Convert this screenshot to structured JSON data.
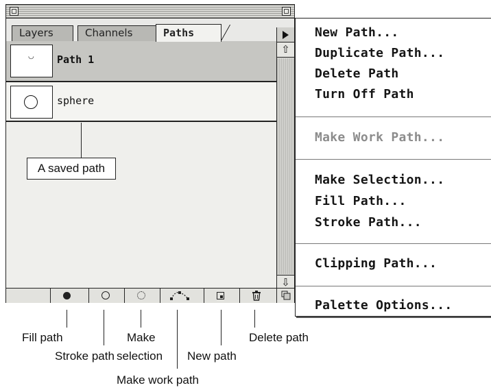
{
  "tabs": [
    "Layers",
    "Channels",
    "Paths"
  ],
  "paths": [
    {
      "name": "Path 1",
      "selected": true
    },
    {
      "name": "sphere",
      "selected": false
    }
  ],
  "callout": "A saved path",
  "toolbar_icons": [
    "fill-path-icon",
    "stroke-path-icon",
    "make-selection-icon",
    "make-work-path-icon",
    "new-path-icon",
    "trash-icon",
    "resize-icon"
  ],
  "menu": {
    "items": [
      {
        "label": "New Path...",
        "enabled": true
      },
      {
        "label": "Duplicate Path...",
        "enabled": true
      },
      {
        "label": "Delete Path",
        "enabled": true
      },
      {
        "label": "Turn Off Path",
        "enabled": true
      },
      {
        "label": "Make Work Path...",
        "enabled": false
      },
      {
        "label": "Make Selection...",
        "enabled": true
      },
      {
        "label": "Fill Path...",
        "enabled": true
      },
      {
        "label": "Stroke Path...",
        "enabled": true
      },
      {
        "label": "Clipping Path...",
        "enabled": true
      },
      {
        "label": "Palette Options...",
        "enabled": true
      }
    ]
  },
  "annotations": {
    "fill_path": "Fill path",
    "stroke_path": "Stroke path",
    "make_selection_1": "Make",
    "make_selection_2": "selection",
    "make_work_path": "Make work path",
    "new_path": "New path",
    "delete_path": "Delete path"
  }
}
